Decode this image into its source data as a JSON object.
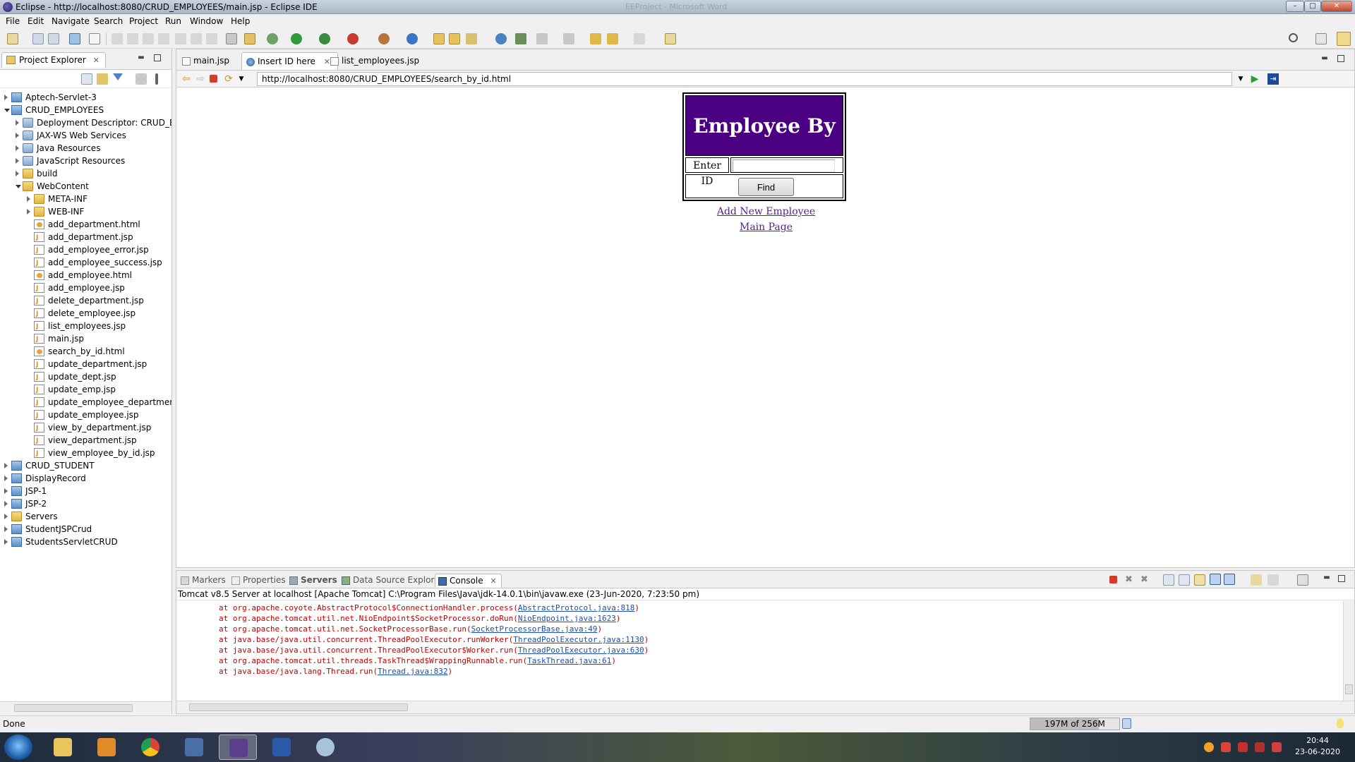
{
  "window": {
    "title": "Eclipse - http://localhost:8080/CRUD_EMPLOYEES/main.jsp - Eclipse IDE",
    "ghost_title": "EEProject - Microsoft Word"
  },
  "menu": [
    "File",
    "Edit",
    "Navigate",
    "Search",
    "Project",
    "Run",
    "Window",
    "Help"
  ],
  "project_explorer": {
    "tab_label": "Project Explorer",
    "tree": [
      {
        "label": "Aptech-Servlet-3",
        "depth": 0,
        "icon": "project",
        "state": "closed"
      },
      {
        "label": "CRUD_EMPLOYEES",
        "depth": 0,
        "icon": "project",
        "state": "open"
      },
      {
        "label": "Deployment Descriptor: CRUD_EM",
        "depth": 1,
        "icon": "special",
        "state": "closed"
      },
      {
        "label": "JAX-WS Web Services",
        "depth": 1,
        "icon": "special",
        "state": "closed"
      },
      {
        "label": "Java Resources",
        "depth": 1,
        "icon": "special",
        "state": "closed"
      },
      {
        "label": "JavaScript Resources",
        "depth": 1,
        "icon": "special",
        "state": "closed"
      },
      {
        "label": "build",
        "depth": 1,
        "icon": "folder",
        "state": "closed"
      },
      {
        "label": "WebContent",
        "depth": 1,
        "icon": "folder",
        "state": "open"
      },
      {
        "label": "META-INF",
        "depth": 2,
        "icon": "folder",
        "state": "closed"
      },
      {
        "label": "WEB-INF",
        "depth": 2,
        "icon": "folder",
        "state": "closed"
      },
      {
        "label": "add_department.html",
        "depth": 2,
        "icon": "html",
        "state": "none"
      },
      {
        "label": "add_department.jsp",
        "depth": 2,
        "icon": "jsp",
        "state": "none"
      },
      {
        "label": "add_employee_error.jsp",
        "depth": 2,
        "icon": "jsp",
        "state": "none"
      },
      {
        "label": "add_employee_success.jsp",
        "depth": 2,
        "icon": "jsp",
        "state": "none"
      },
      {
        "label": "add_employee.html",
        "depth": 2,
        "icon": "html",
        "state": "none"
      },
      {
        "label": "add_employee.jsp",
        "depth": 2,
        "icon": "jsp",
        "state": "none"
      },
      {
        "label": "delete_department.jsp",
        "depth": 2,
        "icon": "jsp",
        "state": "none"
      },
      {
        "label": "delete_employee.jsp",
        "depth": 2,
        "icon": "jsp",
        "state": "none"
      },
      {
        "label": "list_employees.jsp",
        "depth": 2,
        "icon": "jsp",
        "state": "none"
      },
      {
        "label": "main.jsp",
        "depth": 2,
        "icon": "jsp",
        "state": "none"
      },
      {
        "label": "search_by_id.html",
        "depth": 2,
        "icon": "html",
        "state": "none"
      },
      {
        "label": "update_department.jsp",
        "depth": 2,
        "icon": "jsp",
        "state": "none"
      },
      {
        "label": "update_dept.jsp",
        "depth": 2,
        "icon": "jsp",
        "state": "none"
      },
      {
        "label": "update_emp.jsp",
        "depth": 2,
        "icon": "jsp",
        "state": "none"
      },
      {
        "label": "update_employee_department.",
        "depth": 2,
        "icon": "jsp",
        "state": "none"
      },
      {
        "label": "update_employee.jsp",
        "depth": 2,
        "icon": "jsp",
        "state": "none"
      },
      {
        "label": "view_by_department.jsp",
        "depth": 2,
        "icon": "jsp",
        "state": "none"
      },
      {
        "label": "view_department.jsp",
        "depth": 2,
        "icon": "jsp",
        "state": "none"
      },
      {
        "label": "view_employee_by_id.jsp",
        "depth": 2,
        "icon": "jsp",
        "state": "none"
      },
      {
        "label": "CRUD_STUDENT",
        "depth": 0,
        "icon": "project",
        "state": "closed"
      },
      {
        "label": "DisplayRecord",
        "depth": 0,
        "icon": "project",
        "state": "closed"
      },
      {
        "label": "JSP-1",
        "depth": 0,
        "icon": "project",
        "state": "closed"
      },
      {
        "label": "JSP-2",
        "depth": 0,
        "icon": "project",
        "state": "closed"
      },
      {
        "label": "Servers",
        "depth": 0,
        "icon": "folder",
        "state": "closed"
      },
      {
        "label": "StudentJSPCrud",
        "depth": 0,
        "icon": "project",
        "state": "closed"
      },
      {
        "label": "StudentsServletCRUD",
        "depth": 0,
        "icon": "project",
        "state": "closed"
      }
    ]
  },
  "editor_tabs": [
    {
      "label": "main.jsp",
      "active": false,
      "closable": false
    },
    {
      "label": "Insert ID here",
      "active": true,
      "closable": true
    },
    {
      "label": "list_employees.jsp",
      "active": false,
      "closable": false
    }
  ],
  "browser": {
    "url": "http://localhost:8080/CRUD_EMPLOYEES/search_by_id.html"
  },
  "webpage": {
    "heading": "Employee By ID",
    "id_label": "Enter ID",
    "id_value": "",
    "find_button": "Find",
    "link_add": "Add New Employee",
    "link_main": "Main Page",
    "header_color": "#4b0082",
    "link_color": "#5a1d8c"
  },
  "console_tabs": [
    "Markers",
    "Properties",
    "Servers",
    "Data Source Explorer",
    "Console"
  ],
  "console": {
    "header": "Tomcat v8.5 Server at localhost [Apache Tomcat] C:\\Program Files\\Java\\jdk-14.0.1\\bin\\javaw.exe (23-Jun-2020, 7:23:50 pm)",
    "lines": [
      {
        "text": "at org.apache.coyote.AbstractProtocol$ConnectionHandler.process(",
        "link": "AbstractProtocol.java:818"
      },
      {
        "text": "at org.apache.tomcat.util.net.NioEndpoint$SocketProcessor.doRun(",
        "link": "NioEndpoint.java:1623"
      },
      {
        "text": "at org.apache.tomcat.util.net.SocketProcessorBase.run(",
        "link": "SocketProcessorBase.java:49"
      },
      {
        "text": "at java.base/java.util.concurrent.ThreadPoolExecutor.runWorker(",
        "link": "ThreadPoolExecutor.java:1130"
      },
      {
        "text": "at java.base/java.util.concurrent.ThreadPoolExecutor$Worker.run(",
        "link": "ThreadPoolExecutor.java:630"
      },
      {
        "text": "at org.apache.tomcat.util.threads.TaskThread$WrappingRunnable.run(",
        "link": "TaskThread.java:61"
      },
      {
        "text": "at java.base/java.lang.Thread.run(",
        "link": "Thread.java:832"
      }
    ],
    "error_color": "#c00000",
    "link_color": "#1c4eb0"
  },
  "status": {
    "text": "Done",
    "heap": "197M of 256M",
    "heap_used_fraction": 0.77
  },
  "taskbar": {
    "time": "20:44",
    "date": "23-06-2020"
  }
}
